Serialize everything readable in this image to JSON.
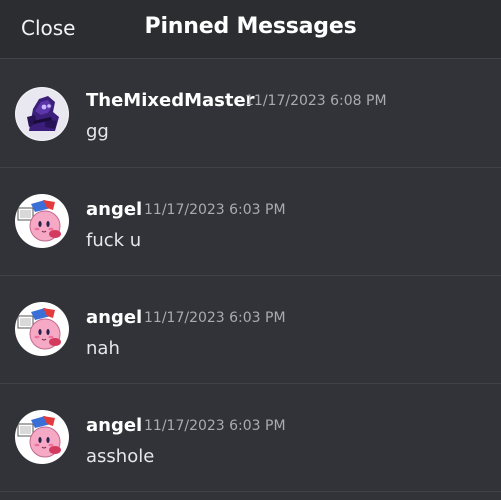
{
  "header": {
    "close_label": "Close",
    "title": "Pinned Messages"
  },
  "messages": [
    {
      "author": "TheMixedMaster",
      "timestamp": "11/17/2023 6:08 PM",
      "content": "gg",
      "avatar_icon": "purple-creature-avatar"
    },
    {
      "author": "angel",
      "timestamp": "11/17/2023 6:03 PM",
      "content": "fuck u",
      "avatar_icon": "pink-kirby-avatar"
    },
    {
      "author": "angel",
      "timestamp": "11/17/2023 6:03 PM",
      "content": "nah",
      "avatar_icon": "pink-kirby-avatar"
    },
    {
      "author": "angel",
      "timestamp": "11/17/2023 6:03 PM",
      "content": "asshole",
      "avatar_icon": "pink-kirby-avatar"
    }
  ],
  "colors": {
    "background": "#313338",
    "header_background": "#2b2d31",
    "divider": "#404249",
    "timestamp": "#a8abb1"
  }
}
